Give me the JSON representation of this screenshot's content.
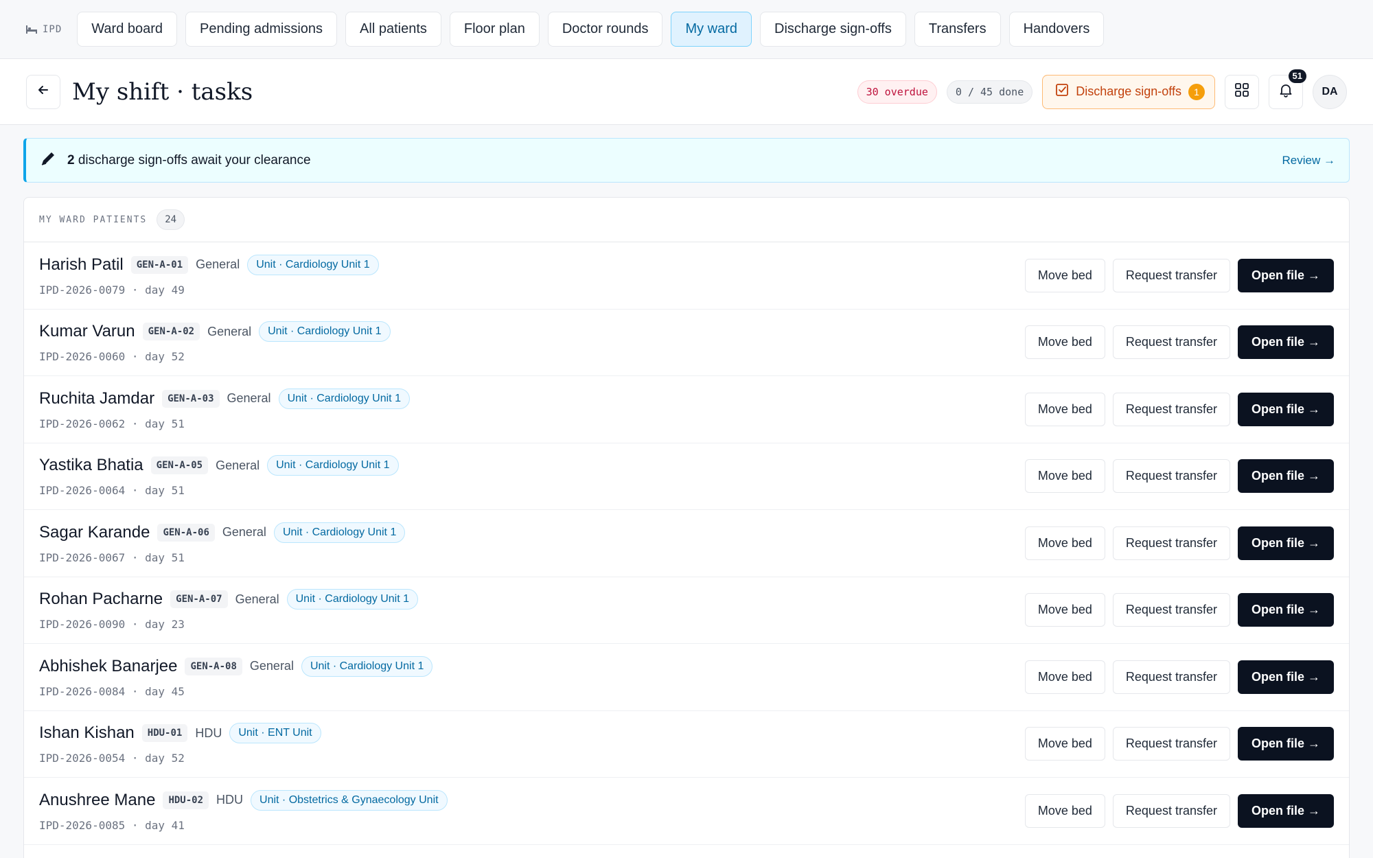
{
  "brand": {
    "label": "IPD",
    "icon": "bed-icon"
  },
  "nav": {
    "tabs": [
      {
        "label": "Ward board",
        "active": false
      },
      {
        "label": "Pending admissions",
        "active": false
      },
      {
        "label": "All patients",
        "active": false
      },
      {
        "label": "Floor plan",
        "active": false
      },
      {
        "label": "Doctor rounds",
        "active": false
      },
      {
        "label": "My ward",
        "active": true
      },
      {
        "label": "Discharge sign-offs",
        "active": false
      },
      {
        "label": "Transfers",
        "active": false
      },
      {
        "label": "Handovers",
        "active": false
      }
    ]
  },
  "header": {
    "title": "My shift · tasks",
    "overdue": "30 overdue",
    "done": "0 / 45 done",
    "discharge_button": "Discharge sign-offs",
    "discharge_count": "1",
    "notifications": "51",
    "avatar_initials": "DA"
  },
  "alert": {
    "count": "2",
    "text": " discharge sign-offs await your clearance",
    "link": "Review →"
  },
  "patients_card": {
    "title": "MY WARD PATIENTS",
    "count": "24",
    "actions": {
      "move": "Move bed",
      "transfer": "Request transfer",
      "open": "Open file →"
    },
    "rows": [
      {
        "name": "Harish Patil",
        "bed": "GEN-A-01",
        "ward": "General",
        "unit": "Unit · Cardiology Unit 1",
        "meta": "IPD-2026-0079 · day 49"
      },
      {
        "name": "Kumar Varun",
        "bed": "GEN-A-02",
        "ward": "General",
        "unit": "Unit · Cardiology Unit 1",
        "meta": "IPD-2026-0060 · day 52"
      },
      {
        "name": "Ruchita Jamdar",
        "bed": "GEN-A-03",
        "ward": "General",
        "unit": "Unit · Cardiology Unit 1",
        "meta": "IPD-2026-0062 · day 51"
      },
      {
        "name": "Yastika Bhatia",
        "bed": "GEN-A-05",
        "ward": "General",
        "unit": "Unit · Cardiology Unit 1",
        "meta": "IPD-2026-0064 · day 51"
      },
      {
        "name": "Sagar Karande",
        "bed": "GEN-A-06",
        "ward": "General",
        "unit": "Unit · Cardiology Unit 1",
        "meta": "IPD-2026-0067 · day 51"
      },
      {
        "name": "Rohan Pacharne",
        "bed": "GEN-A-07",
        "ward": "General",
        "unit": "Unit · Cardiology Unit 1",
        "meta": "IPD-2026-0090 · day 23"
      },
      {
        "name": "Abhishek Banarjee",
        "bed": "GEN-A-08",
        "ward": "General",
        "unit": "Unit · Cardiology Unit 1",
        "meta": "IPD-2026-0084 · day 45"
      },
      {
        "name": "Ishan Kishan",
        "bed": "HDU-01",
        "ward": "HDU",
        "unit": "Unit · ENT Unit",
        "meta": "IPD-2026-0054 · day 52"
      },
      {
        "name": "Anushree Mane",
        "bed": "HDU-02",
        "ward": "HDU",
        "unit": "Unit · Obstetrics & Gynaecology Unit",
        "meta": "IPD-2026-0085 · day 41"
      }
    ]
  }
}
